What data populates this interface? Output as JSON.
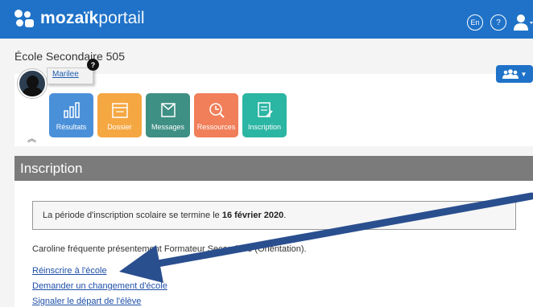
{
  "header": {
    "brand_bold": "mozaïk",
    "brand_light": "portail",
    "lang_button": "En",
    "help_button": "?",
    "user_icon": "user-icon"
  },
  "school": {
    "name": "École Secondaire 505"
  },
  "profile": {
    "name": "Marilee",
    "badge": "?"
  },
  "tiles": [
    {
      "label": "Résultats",
      "color": "#4a90d9",
      "icon": "chart-icon"
    },
    {
      "label": "Dossier",
      "color": "#f5a742",
      "icon": "folder-icon"
    },
    {
      "label": "Messages",
      "color": "#3e8f84",
      "icon": "message-icon"
    },
    {
      "label": "Ressources",
      "color": "#f07f5a",
      "icon": "resources-icon"
    },
    {
      "label": "Inscription",
      "color": "#2bb5a3",
      "icon": "form-icon"
    }
  ],
  "section": {
    "title": "Inscription"
  },
  "notice": {
    "text": "La période d'inscription scolaire se termine le ",
    "date": "16 février 2020",
    "end": "."
  },
  "attendance": {
    "text": "Caroline fréquente présentement Formateur Secondaire (Orientation)."
  },
  "links": [
    "Réinscrire à l'école",
    "Demander un changement d'école",
    "Signaler le départ de l'élève"
  ],
  "colors": {
    "topbar": "#1f72c8",
    "section_bar": "#7b7b7b",
    "arrow": "#2a4f8f"
  }
}
